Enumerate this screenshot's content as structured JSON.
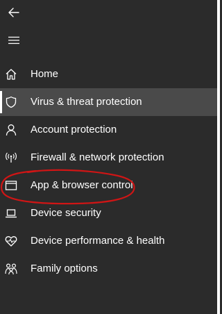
{
  "colors": {
    "background": "#2b2b2b",
    "selected_background": "#4a4a4a",
    "text": "#ffffff",
    "annotation": "#d01515"
  },
  "header": {
    "back_icon": "back-arrow-icon",
    "menu_icon": "hamburger-menu-icon"
  },
  "nav": {
    "items": [
      {
        "label": "Home",
        "icon": "home-icon",
        "selected": false
      },
      {
        "label": "Virus & threat protection",
        "icon": "shield-icon",
        "selected": true
      },
      {
        "label": "Account protection",
        "icon": "person-icon",
        "selected": false
      },
      {
        "label": "Firewall & network protection",
        "icon": "wifi-antenna-icon",
        "selected": false
      },
      {
        "label": "App & browser control",
        "icon": "app-window-icon",
        "selected": false
      },
      {
        "label": "Device security",
        "icon": "laptop-icon",
        "selected": false
      },
      {
        "label": "Device performance & health",
        "icon": "heart-pulse-icon",
        "selected": false
      },
      {
        "label": "Family options",
        "icon": "family-icon",
        "selected": false
      }
    ]
  }
}
